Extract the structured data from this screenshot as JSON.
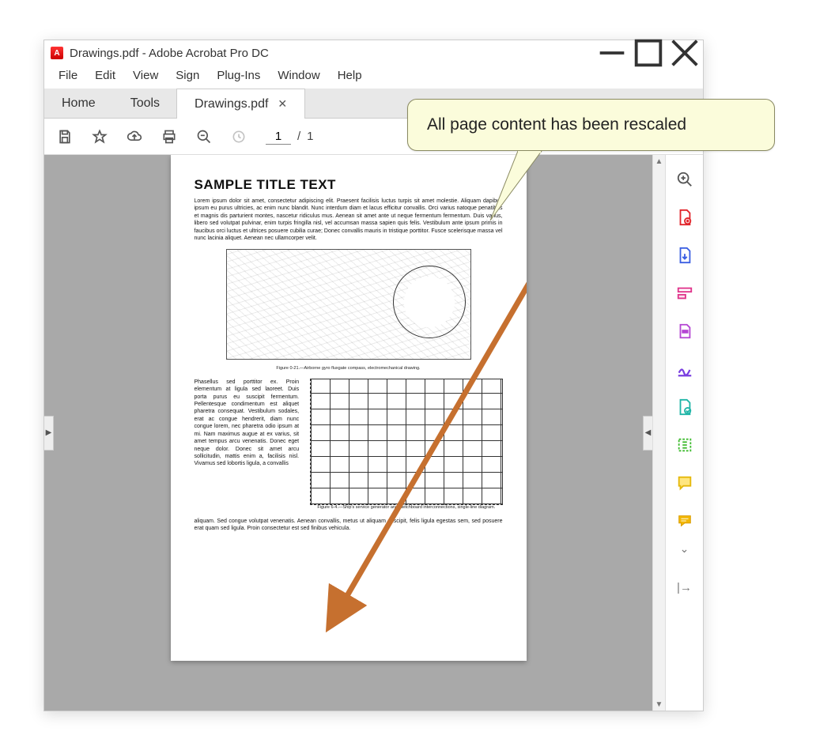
{
  "window": {
    "title": "Drawings.pdf - Adobe Acrobat Pro DC",
    "min_label": "Minimize",
    "max_label": "Maximize",
    "close_label": "Close"
  },
  "menu": {
    "file": "File",
    "edit": "Edit",
    "view": "View",
    "sign": "Sign",
    "plugins": "Plug-Ins",
    "window": "Window",
    "help": "Help"
  },
  "tabs": {
    "home": "Home",
    "tools": "Tools",
    "doc": "Drawings.pdf"
  },
  "toolbar": {
    "current_page": "1",
    "total_pages": "1",
    "slash": "/"
  },
  "sidepanel_icons": [
    "search-zoom-icon",
    "create-pdf-icon",
    "export-pdf-icon",
    "edit-pdf-icon",
    "redact-icon",
    "sign-icon",
    "convert-icon",
    "optimize-icon",
    "comment-icon",
    "sticky-note-icon"
  ],
  "document": {
    "title": "SAMPLE TITLE TEXT",
    "para1": "Lorem ipsum dolor sit amet, consectetur adipiscing elit. Praesent facilisis luctus turpis sit amet molestie. Aliquam dapibus ipsum eu purus ultricies, ac enim nunc blandit. Nunc interdum diam et lacus efficitur convallis. Orci varius natoque penatibus et magnis dis parturient montes, nascetur ridiculus mus. Aenean sit amet ante ut neque fermentum fermentum. Duis varius, libero sed volutpat pulvinar, enim turpis fringilla nisl, vel accumsan massa sapien quis felis. Vestibulum ante ipsum primis in faucibus orci luctus et ultrices posuere cubilia curae; Donec convallis mauris in tristique porttitor. Fusce scelerisque massa vel nunc lacinia aliquet. Aenean nec ullamcorper velit.",
    "caption1": "Figure 0-21.—Airborne gyro fluxgate compass, electromechanical drawing.",
    "para2": "Phasellus sed porttitor ex. Proin elementum at ligula sed laoreet. Duis porta purus eu suscipit fermentum. Pellentesque condimentum est aliquet pharetra consequat. Vestibulum sodales, erat ac congue hendrerit, diam nunc congue lorem, nec pharetra odio ipsum at mi. Nam maximus augue at ex varius, sit amet tempus arcu venenatis. Donec eget neque dolor. Donec sit amet arcu sollicitudin, mattis enim a, facilisis nisl. Vivamus sed lobortis ligula, a convallis",
    "caption2": "Figure 6-4.—Ship's service generator and switchboard interconnections, single-line diagram.",
    "para3": "aliquam. Sed congue volutpat venenatis. Aenean convallis, metus ut aliquam suscipit, felis ligula egestas sem, sed posuere erat quam sed ligula. Proin consectetur est sed finibus vehicula."
  },
  "callout": {
    "text": "All page content has been rescaled"
  }
}
